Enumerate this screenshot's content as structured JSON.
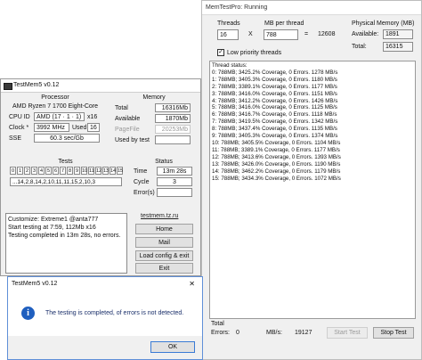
{
  "memtestpro": {
    "title": "MemTestPro: Running",
    "threads_label": "Threads",
    "threads_value": "16",
    "multiply_sign": "X",
    "mb_per_thread_label": "MB per thread",
    "mb_per_thread_value": "788",
    "equals_sign": "=",
    "total_mb": "12608",
    "physical_memory_label": "Physical Memory (MB)",
    "available_label": "Available:",
    "available_value": "1891",
    "total_label": "Total:",
    "total_value": "16315",
    "low_priority_label": "Low priority threads",
    "low_priority_checked": true,
    "thread_status_title": "Thread status:",
    "thread_lines": [
      "0: 788MB; 3425.2% Coverage, 0 Errors. 1278 MB/s",
      "1: 788MB; 3405.3% Coverage, 0 Errors. 1180 MB/s",
      "2: 788MB; 3389.1% Coverage, 0 Errors. 1177 MB/s",
      "3: 788MB; 3416.0% Coverage, 0 Errors. 1151 MB/s",
      "4: 788MB; 3412.2% Coverage, 0 Errors. 1426 MB/s",
      "5: 788MB; 3416.0% Coverage, 0 Errors. 1125 MB/s",
      "6: 788MB; 3416.7% Coverage, 0 Errors. 1118 MB/s",
      "7: 788MB; 3419.5% Coverage, 0 Errors. 1342 MB/s",
      "8: 788MB; 3437.4% Coverage, 0 Errors. 1135 MB/s",
      "9: 788MB; 3405.3% Coverage, 0 Errors. 1374 MB/s",
      "10: 788MB; 3405.5% Coverage, 0 Errors. 1104 MB/s",
      "11: 788MB; 3389.1% Coverage, 0 Errors. 1177 MB/s",
      "12: 788MB; 3413.6% Coverage, 0 Errors. 1393 MB/s",
      "13: 788MB; 3426.0% Coverage, 0 Errors. 1190 MB/s",
      "14: 788MB; 3462.2% Coverage, 0 Errors. 1179 MB/s",
      "15: 788MB; 3434.3% Coverage, 0 Errors. 1072 MB/s"
    ],
    "total_footer_label": "Total",
    "errors_label": "Errors:",
    "errors_value": "0",
    "mbs_label": "MB/s:",
    "mbs_value": "19127",
    "start_test_label": "Start Test",
    "stop_test_label": "Stop Test"
  },
  "testmem5": {
    "title": "TestMem5 v0.12",
    "processor_title": "Processor",
    "processor_name": "AMD Ryzen 7 1700 Eight-Core",
    "cpu_id_label": "CPU ID",
    "cpu_id_value": "AMD  (17 · 1 · 1)",
    "cpu_id_cores": "x16",
    "clock_label": "Clock *",
    "clock_value": "3992 MHz",
    "used_label": "Used",
    "used_value": "16",
    "sse_label": "SSE",
    "sse_value": "60.3 sec/Gb",
    "memory_title": "Memory",
    "mem_total_label": "Total",
    "mem_total_value": "16316Mb",
    "mem_available_label": "Available",
    "mem_available_value": "1870Mb",
    "pagefile_label": "PageFile",
    "pagefile_value": "20253Mb",
    "used_by_test_label": "Used by test",
    "used_by_test_value": "",
    "tests_title": "Tests",
    "test_numbers": [
      "0",
      "1",
      "2",
      "3",
      "4",
      "5",
      "6",
      "7",
      "8",
      "9",
      "10",
      "11",
      "12",
      "13",
      "14",
      "15"
    ],
    "test_sequence": "...14,2,8,14,2,10,11,11,15,2,10,3",
    "status_title": "Status",
    "time_label": "Time",
    "time_value": "13m 28s",
    "cycle_label": "Cycle",
    "cycle_value": "3",
    "errors_label": "Error(s)",
    "errors_value": "",
    "log_lines": [
      "Customize: Extreme1 @anta777",
      "Start testing at 7:59, 112Mb x16",
      "Testing completed in 13m 28s, no errors."
    ],
    "website": "testmem.tz.ru",
    "home_label": "Home",
    "mail_label": "Mail",
    "load_config_label": "Load config & exit",
    "exit_label": "Exit"
  },
  "dialog": {
    "title": "TestMem5 v0.12",
    "close_glyph": "✕",
    "message": "The testing is completed, of errors is not detected.",
    "ok_label": "OK",
    "info_glyph": "i"
  },
  "colors": {
    "info_icon": "#1f5fbf",
    "title_active_border": "#5f8fd8"
  }
}
